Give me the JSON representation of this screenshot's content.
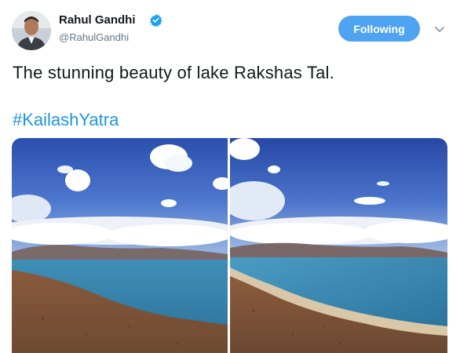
{
  "tweet": {
    "author_name": "Rahul Gandhi",
    "author_handle": "@RahulGandhi",
    "verified": true,
    "follow_button_label": "Following",
    "text": "The stunning beauty of lake Rakshas Tal.",
    "hashtag": "#KailashYatra",
    "photos": [
      {
        "subject": "lake-landscape-left"
      },
      {
        "subject": "lake-landscape-right"
      }
    ]
  },
  "colors": {
    "accent": "#4ea4f0",
    "link": "#1b95e0",
    "secondary_text": "#657786"
  },
  "icons": {
    "verified": "verified-badge-icon",
    "menu": "chevron-down-icon"
  }
}
